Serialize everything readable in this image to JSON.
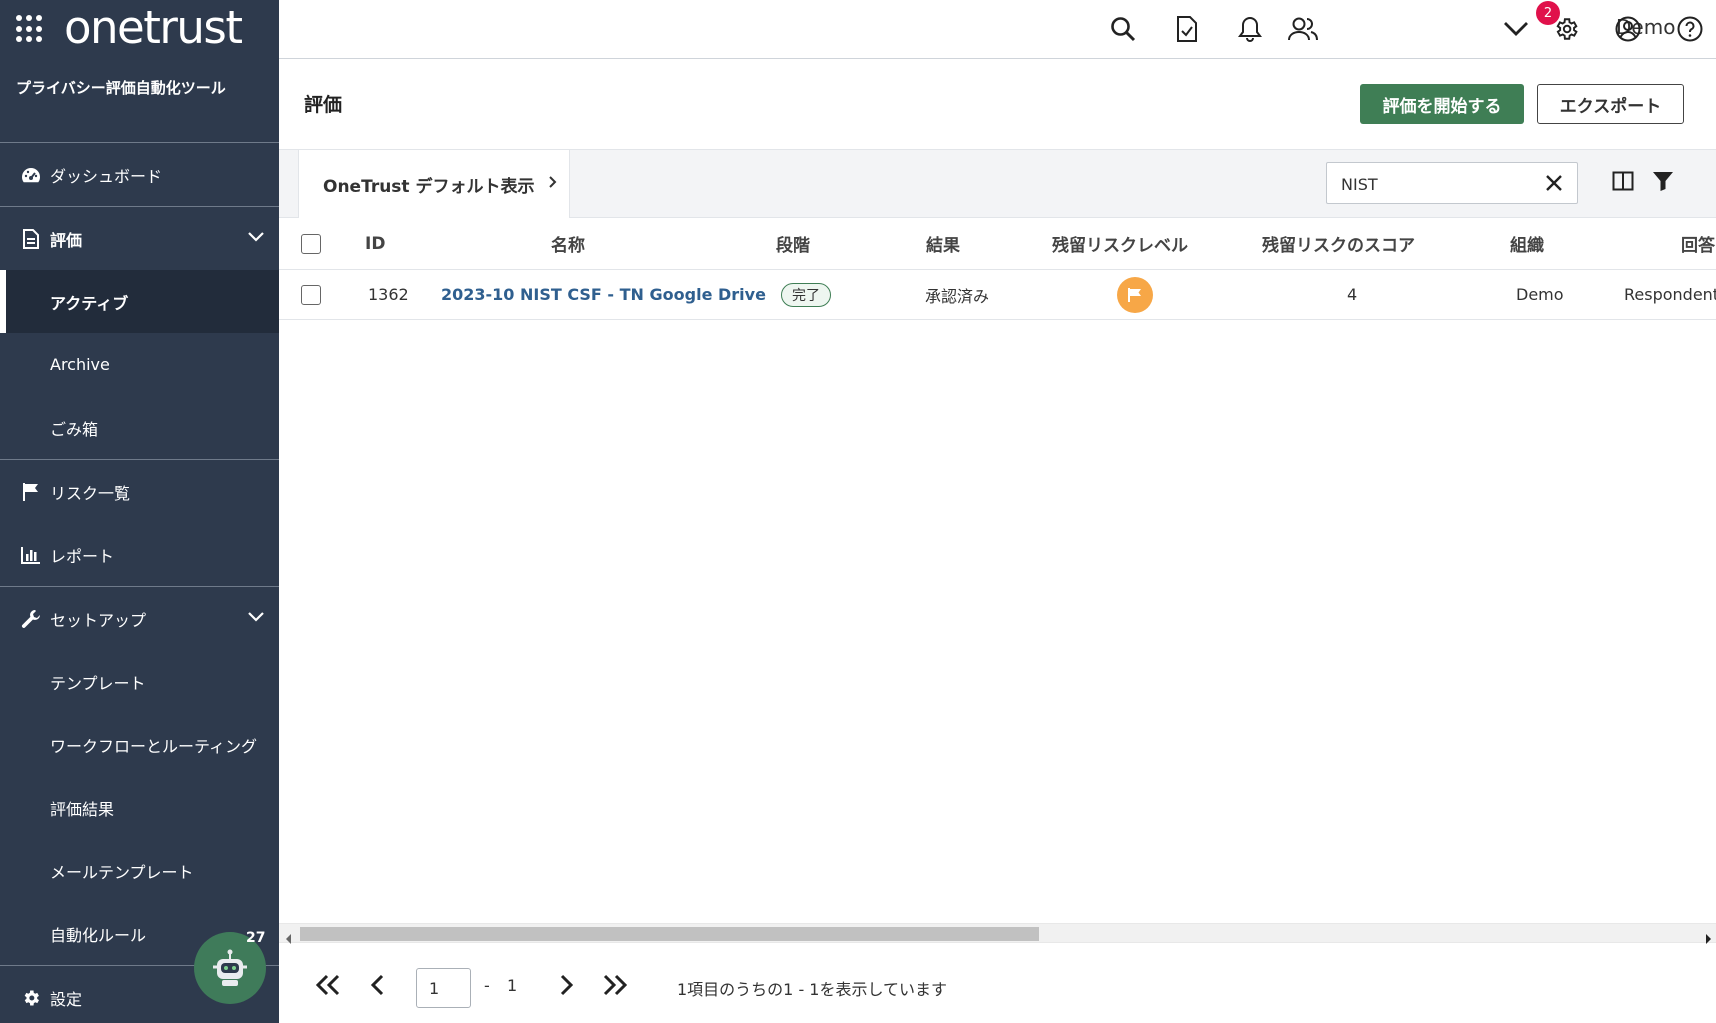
{
  "brand": {
    "logo_text": "onetrust",
    "app_name": "プライバシー評価自動化ツール"
  },
  "sidebar": {
    "dashboard": "ダッシュボード",
    "assessments": "評価",
    "assessments_sub": [
      "アクティブ",
      "Archive",
      "ごみ箱"
    ],
    "risks": "リスク一覧",
    "reports": "レポート",
    "setup": "セットアップ",
    "setup_sub": [
      "テンプレート",
      "ワークフローとルーティング",
      "評価結果",
      "メールテンプレート",
      "自動化ルール"
    ],
    "settings": "設定",
    "bot_count": "27"
  },
  "topbar": {
    "notification_count": "2",
    "org_name": "Demo",
    "icons": [
      "search-icon",
      "task-icon",
      "bell-icon",
      "users-icon",
      "chevron-down-icon",
      "gear-icon",
      "profile-icon",
      "help-icon"
    ]
  },
  "header": {
    "title": "評価",
    "start_button": "評価を開始する",
    "export_button": "エクスポート"
  },
  "viewbar": {
    "view_name": "OneTrust デフォルト表示",
    "search_value": "NIST"
  },
  "table": {
    "columns": [
      "ID",
      "名称",
      "段階",
      "結果",
      "残留リスクレベル",
      "残留リスクのスコア",
      "組織",
      "回答"
    ],
    "rows": [
      {
        "id": "1362",
        "name": "2023-10 NIST CSF - TN Google Drive",
        "stage": "完了",
        "result": "承認済み",
        "risk_level": "medium",
        "risk_score": "4",
        "org": "Demo",
        "respondent": "Respondent"
      }
    ]
  },
  "pagination": {
    "current_page": "1",
    "separator": "-",
    "total_pages": "1",
    "summary": "1項目のうちの1 - 1を表示しています"
  },
  "colors": {
    "sidebar": "#2e3a4d",
    "primary": "#3f7e55",
    "badge": "#e0114b",
    "risk_medium": "#f7a747",
    "link": "#2f5f8f"
  }
}
